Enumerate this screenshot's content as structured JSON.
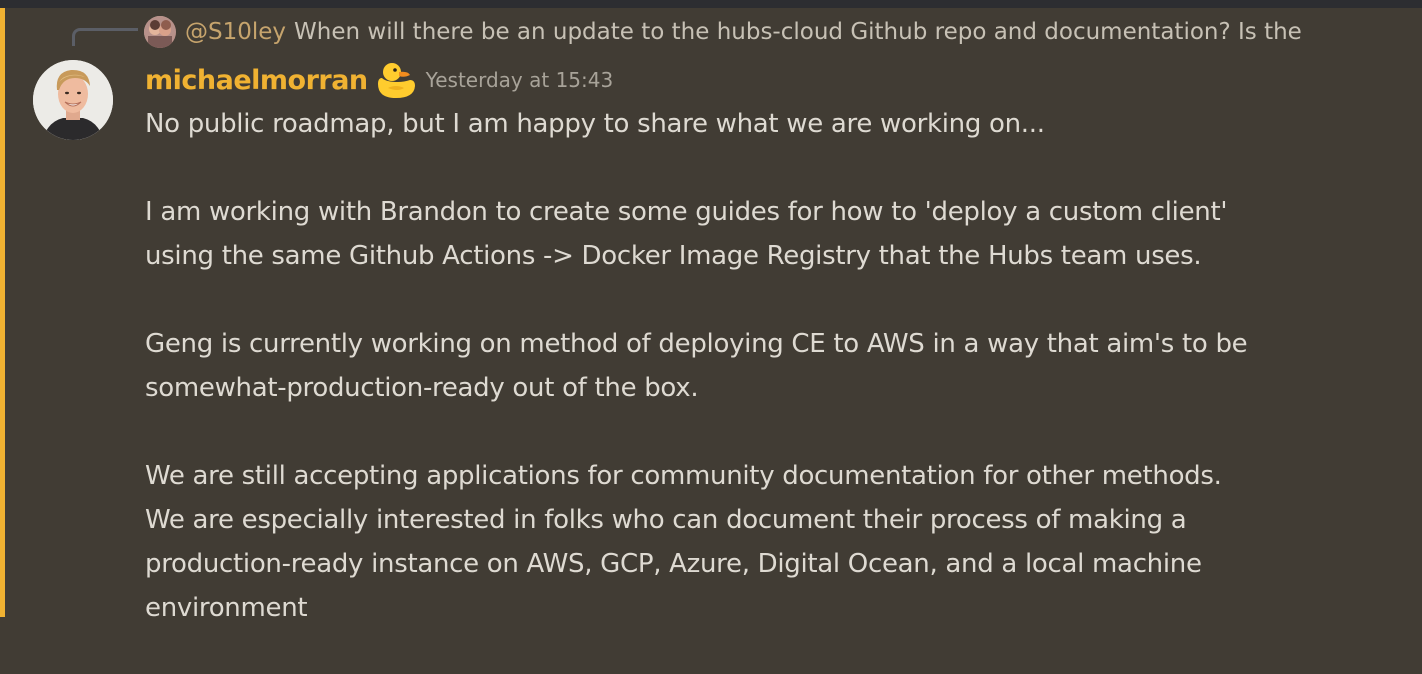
{
  "reply": {
    "author": "@S10ley",
    "text": "When will there be an update to the hubs-cloud Github repo and documentation? Is the"
  },
  "message": {
    "author": "michaelmorran",
    "author_color": "#f0b232",
    "badge_icon": "rubber-duck-icon",
    "timestamp": "Yesterday at 15:43",
    "paragraphs": [
      [
        "No public roadmap, but I am happy to share what we are working on..."
      ],
      [
        "I am working with Brandon to create some guides for how to 'deploy a custom client'",
        "using the same Github Actions -> Docker Image Registry that the Hubs team uses."
      ],
      [
        "Geng is currently working on method of deploying CE to AWS in a way that aim's to be",
        "somewhat-production-ready out of the box."
      ],
      [
        "We are still accepting applications for community documentation for other methods.",
        "We are especially interested in folks who can document their process of making a",
        "production-ready instance on AWS, GCP, Azure, Digital Ocean, and a local machine",
        "environment"
      ]
    ]
  },
  "colors": {
    "background": "#413c34",
    "highlight": "#f0b232",
    "reply_author": "#c6a46d"
  }
}
